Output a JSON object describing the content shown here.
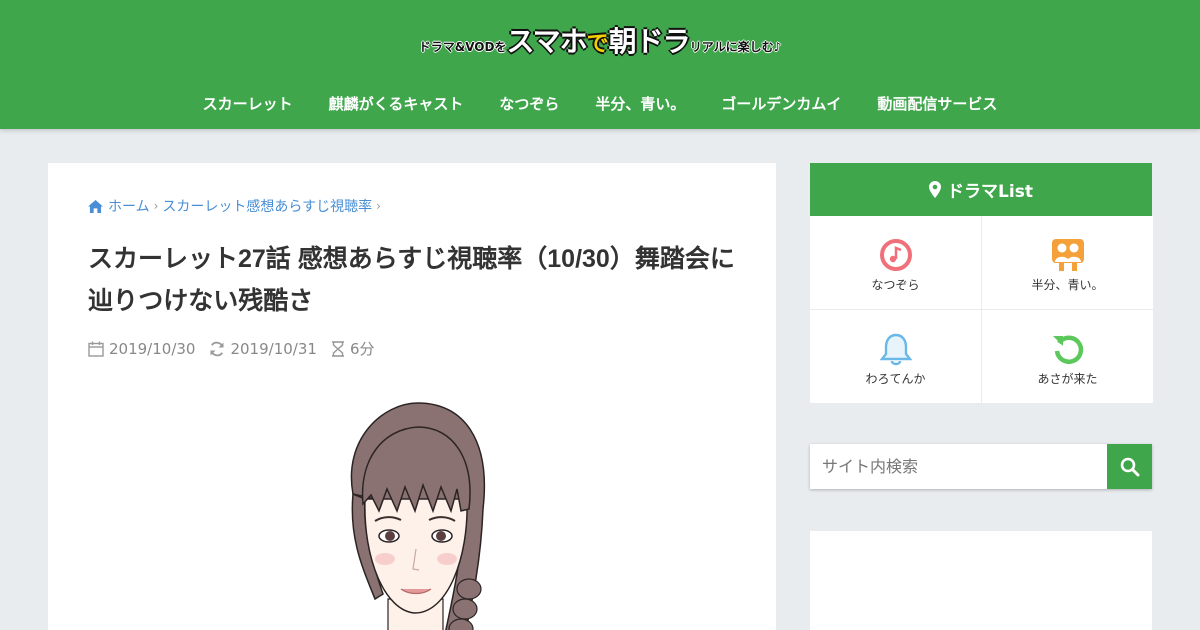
{
  "logo": {
    "part1": "ドラマ&VODを",
    "part2": "スマホ",
    "part3": "で",
    "part4": "朝ドラ",
    "part5": "リアルに楽しむ♪"
  },
  "nav": {
    "items": [
      {
        "label": "スカーレット"
      },
      {
        "label": "麒麟がくるキャスト"
      },
      {
        "label": "なつぞら"
      },
      {
        "label": "半分、青い。"
      },
      {
        "label": "ゴールデンカムイ"
      },
      {
        "label": "動画配信サービス"
      }
    ]
  },
  "breadcrumb": {
    "home": "ホーム",
    "category": "スカーレット感想あらすじ視聴率"
  },
  "article": {
    "title": "スカーレット27話 感想あらすじ視聴率（10/30）舞踏会に辿りつけない残酷さ",
    "published": "2019/10/30",
    "updated": "2019/10/31",
    "read_time": "6分"
  },
  "sidebar": {
    "heading": "ドラマList",
    "items": [
      {
        "label": "なつぞら",
        "icon": "music-note-icon",
        "color": "#f06f7a"
      },
      {
        "label": "半分、青い。",
        "icon": "people-icon",
        "color": "#f5a13a"
      },
      {
        "label": "わろてんか",
        "icon": "bell-icon",
        "color": "#6ab8e8"
      },
      {
        "label": "あさが来た",
        "icon": "refresh-icon",
        "color": "#5cc85c"
      }
    ]
  },
  "search": {
    "placeholder": "サイト内検索"
  },
  "colors": {
    "brand_green": "#3fa64c",
    "link_blue": "#4a8fd6",
    "page_bg": "#e9ecef"
  }
}
